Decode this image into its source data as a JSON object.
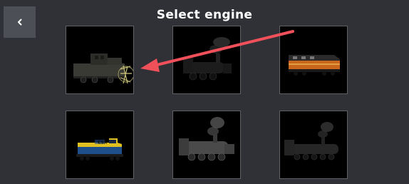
{
  "header": {
    "title": "Select engine"
  },
  "back_button": {
    "icon": "chevron-left-icon"
  },
  "engines": [
    {
      "livery": "dark-diesel-switcher"
    },
    {
      "livery": "black-steam-locomotive"
    },
    {
      "livery": "orange-diesel-cab"
    },
    {
      "livery": "csx-blue-yellow-diesel",
      "badge": "CSX"
    },
    {
      "livery": "grey-steam-locomotive"
    },
    {
      "livery": "large-black-steam-locomotive"
    }
  ],
  "annotation": {
    "arrow_color": "#f0505a"
  },
  "colors": {
    "background": "#2f3136",
    "back_button": "#4c4f55",
    "card_border": "#5f6166",
    "title": "#ffffff"
  }
}
